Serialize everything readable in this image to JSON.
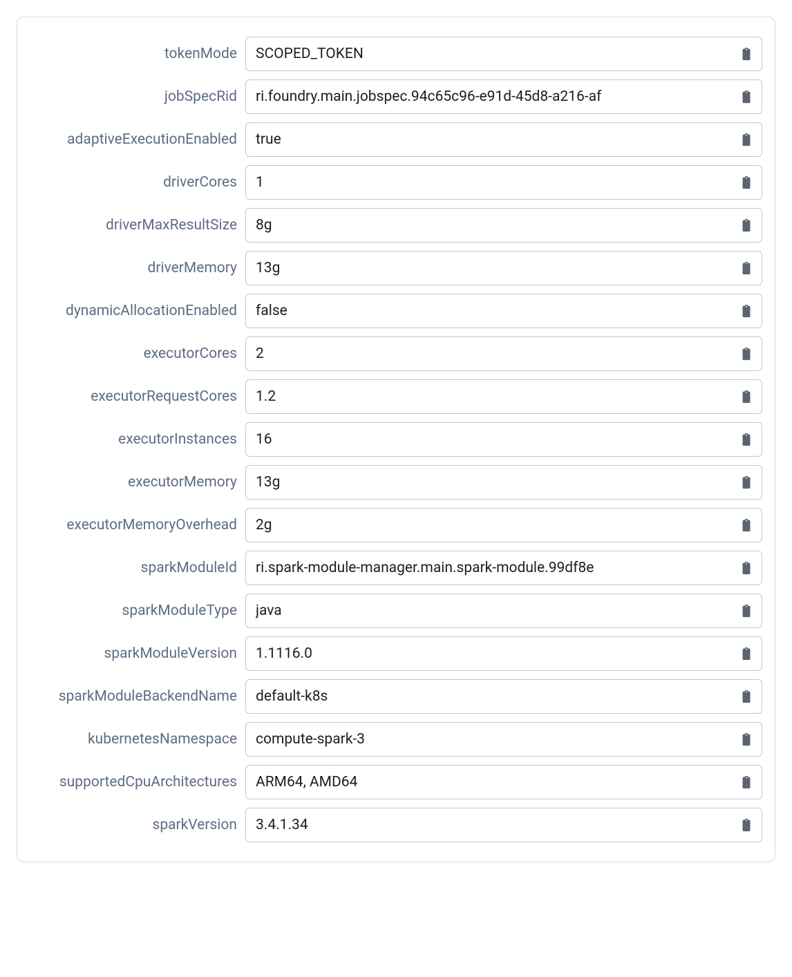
{
  "fields": [
    {
      "key": "tokenMode",
      "label": "tokenMode",
      "value": "SCOPED_TOKEN"
    },
    {
      "key": "jobSpecRid",
      "label": "jobSpecRid",
      "value": "ri.foundry.main.jobspec.94c65c96-e91d-45d8-a216-af"
    },
    {
      "key": "adaptiveExecutionEnabled",
      "label": "adaptiveExecutionEnabled",
      "value": "true"
    },
    {
      "key": "driverCores",
      "label": "driverCores",
      "value": "1"
    },
    {
      "key": "driverMaxResultSize",
      "label": "driverMaxResultSize",
      "value": "8g"
    },
    {
      "key": "driverMemory",
      "label": "driverMemory",
      "value": "13g"
    },
    {
      "key": "dynamicAllocationEnabled",
      "label": "dynamicAllocationEnabled",
      "value": "false"
    },
    {
      "key": "executorCores",
      "label": "executorCores",
      "value": "2"
    },
    {
      "key": "executorRequestCores",
      "label": "executorRequestCores",
      "value": "1.2"
    },
    {
      "key": "executorInstances",
      "label": "executorInstances",
      "value": "16"
    },
    {
      "key": "executorMemory",
      "label": "executorMemory",
      "value": "13g"
    },
    {
      "key": "executorMemoryOverhead",
      "label": "executorMemoryOverhead",
      "value": "2g"
    },
    {
      "key": "sparkModuleId",
      "label": "sparkModuleId",
      "value": "ri.spark-module-manager.main.spark-module.99df8e"
    },
    {
      "key": "sparkModuleType",
      "label": "sparkModuleType",
      "value": "java"
    },
    {
      "key": "sparkModuleVersion",
      "label": "sparkModuleVersion",
      "value": "1.1116.0"
    },
    {
      "key": "sparkModuleBackendName",
      "label": "sparkModuleBackendName",
      "value": "default-k8s"
    },
    {
      "key": "kubernetesNamespace",
      "label": "kubernetesNamespace",
      "value": "compute-spark-3"
    },
    {
      "key": "supportedCpuArchitectures",
      "label": "supportedCpuArchitectures",
      "value": "ARM64, AMD64"
    },
    {
      "key": "sparkVersion",
      "label": "sparkVersion",
      "value": "3.4.1.34"
    }
  ],
  "icons": {
    "clipboard": "clipboard-icon"
  }
}
